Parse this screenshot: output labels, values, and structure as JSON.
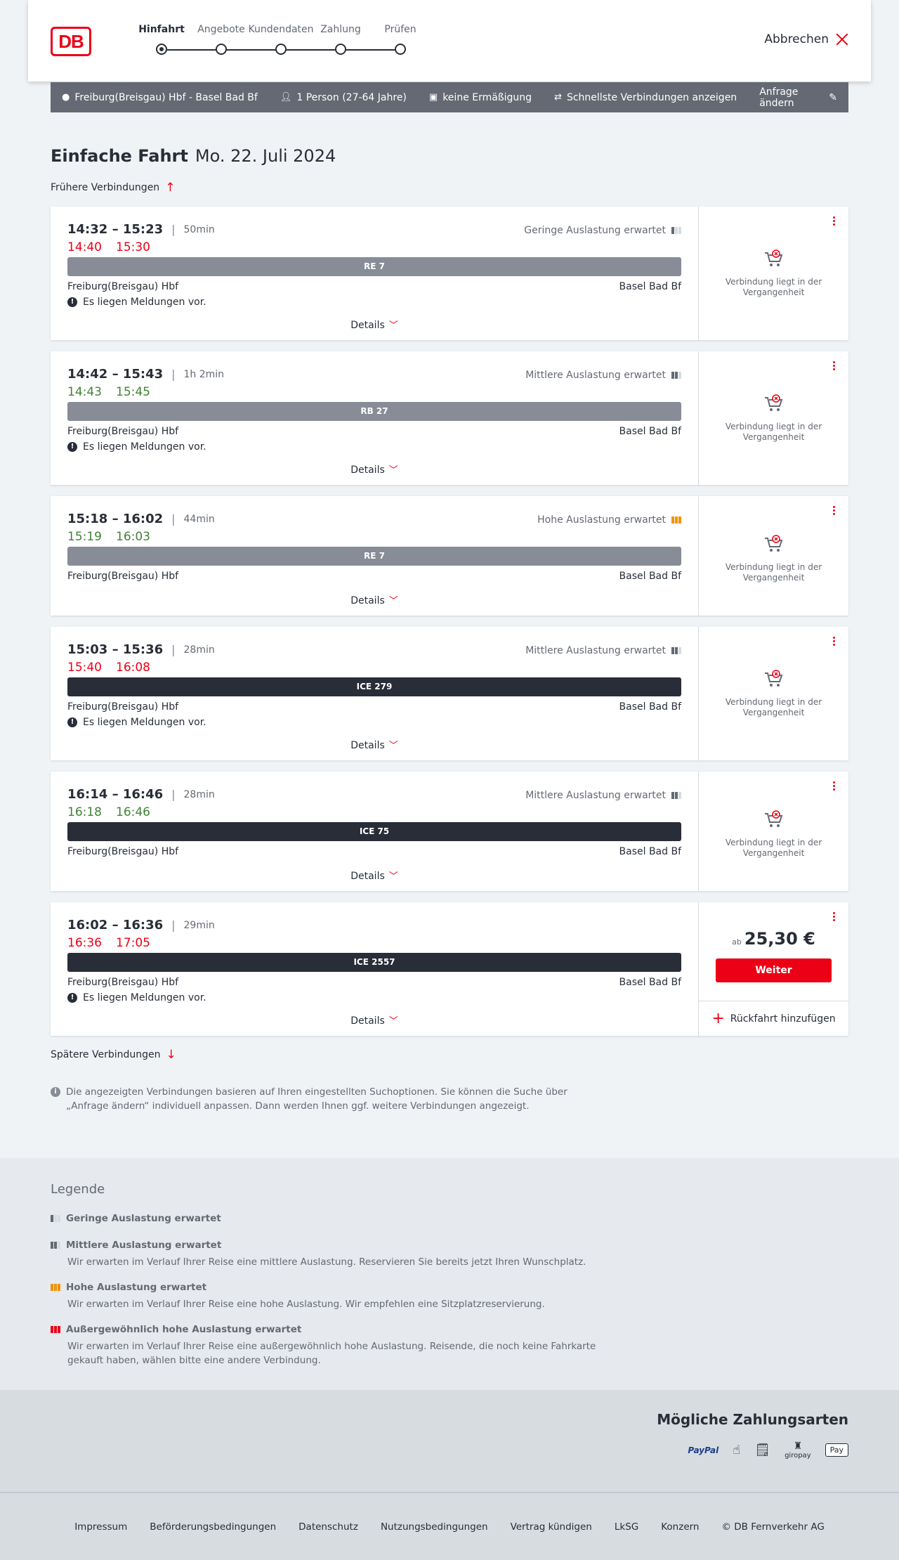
{
  "header": {
    "logo": "DB",
    "steps": [
      "Hinfahrt",
      "Angebote",
      "Kundendaten",
      "Zahlung",
      "Prüfen"
    ],
    "active_step": 0,
    "cancel_label": "Abbrechen"
  },
  "search": {
    "route": "Freiburg(Breisgau) Hbf - Basel Bad Bf",
    "travellers": "1 Person (27-64 Jahre)",
    "discount": "keine Ermäßigung",
    "fastest": "Schnellste Verbindungen anzeigen",
    "edit_label": "Anfrage ändern"
  },
  "page": {
    "trip_type": "Einfache Fahrt",
    "date": "Mo. 22. Juli 2024",
    "earlier": "Frühere Verbindungen",
    "later": "Spätere Verbindungen",
    "info": "Die angezeigten Verbindungen basieren auf Ihren eingestellten Suchoptionen. Sie können die Suche über „Anfrage ändern“ individuell anpassen. Dann werden Ihnen ggf. weitere Verbindungen angezeigt."
  },
  "connections": [
    {
      "times": "14:32 – 15:23",
      "duration": "50min",
      "rt_dep": "14:40",
      "rt_arr": "15:30",
      "rt_status": "late",
      "load": "Geringe Auslastung erwartet",
      "load_level": 1,
      "train": "RE 7",
      "train_type": "reg",
      "from": "Freiburg(Breisgau) Hbf",
      "to": "Basel Bad Bf",
      "message": "Es liegen Meldungen vor.",
      "details": "Details",
      "past": "Verbindung liegt in der Vergangenheit"
    },
    {
      "times": "14:42 – 15:43",
      "duration": "1h 2min",
      "rt_dep": "14:43",
      "rt_arr": "15:45",
      "rt_status": "ok",
      "load": "Mittlere Auslastung erwartet",
      "load_level": 2,
      "train": "RB 27",
      "train_type": "reg",
      "from": "Freiburg(Breisgau) Hbf",
      "to": "Basel Bad Bf",
      "message": "Es liegen Meldungen vor.",
      "details": "Details",
      "past": "Verbindung liegt in der Vergangenheit"
    },
    {
      "times": "15:18 – 16:02",
      "duration": "44min",
      "rt_dep": "15:19",
      "rt_arr": "16:03",
      "rt_status": "ok",
      "load": "Hohe Auslastung erwartet",
      "load_level": 3,
      "train": "RE 7",
      "train_type": "reg",
      "from": "Freiburg(Breisgau) Hbf",
      "to": "Basel Bad Bf",
      "message": "",
      "details": "Details",
      "past": "Verbindung liegt in der Vergangenheit"
    },
    {
      "times": "15:03 – 15:36",
      "duration": "28min",
      "rt_dep": "15:40",
      "rt_arr": "16:08",
      "rt_status": "late",
      "load": "Mittlere Auslastung erwartet",
      "load_level": 2,
      "train": "ICE 279",
      "train_type": "ice",
      "from": "Freiburg(Breisgau) Hbf",
      "to": "Basel Bad Bf",
      "message": "Es liegen Meldungen vor.",
      "details": "Details",
      "past": "Verbindung liegt in der Vergangenheit"
    },
    {
      "times": "16:14 – 16:46",
      "duration": "28min",
      "rt_dep": "16:18",
      "rt_arr": "16:46",
      "rt_status": "ok",
      "load": "Mittlere Auslastung erwartet",
      "load_level": 2,
      "train": "ICE 75",
      "train_type": "ice",
      "from": "Freiburg(Breisgau) Hbf",
      "to": "Basel Bad Bf",
      "message": "",
      "details": "Details",
      "past": "Verbindung liegt in der Vergangenheit"
    },
    {
      "times": "16:02 – 16:36",
      "duration": "29min",
      "rt_dep": "16:36",
      "rt_arr": "17:05",
      "rt_status": "late",
      "load": "",
      "load_level": 0,
      "train": "ICE 2557",
      "train_type": "ice",
      "from": "Freiburg(Breisgau) Hbf",
      "to": "Basel Bad Bf",
      "message": "Es liegen Meldungen vor.",
      "details": "Details",
      "price_prefix": "ab",
      "price": "25,30 €",
      "button": "Weiter",
      "return_label": "Rückfahrt hinzufügen"
    }
  ],
  "legend": {
    "title": "Legende",
    "items": [
      {
        "title": "Geringe Auslastung erwartet",
        "level": 1,
        "desc": ""
      },
      {
        "title": "Mittlere Auslastung erwartet",
        "level": 2,
        "desc": "Wir erwarten im Verlauf Ihrer Reise eine mittlere Auslastung. Reservieren Sie bereits jetzt Ihren Wunschplatz."
      },
      {
        "title": "Hohe Auslastung erwartet",
        "level": 3,
        "desc": "Wir erwarten im Verlauf Ihrer Reise eine hohe Auslastung. Wir empfehlen eine Sitzplatzreservierung."
      },
      {
        "title": "Außergewöhnlich hohe Auslastung erwartet",
        "level": 4,
        "desc": "Wir erwarten im Verlauf Ihrer Reise eine außergewöhnlich hohe Auslastung. Reisende, die noch keine Fahrkarte gekauft haben, wählen bitte eine andere Verbindung."
      }
    ]
  },
  "payment": {
    "title": "Mögliche Zahlungsarten",
    "methods": [
      "PayPal",
      "giropay",
      "Pay"
    ]
  },
  "footer": {
    "links": [
      "Impressum",
      "Beförderungsbedingungen",
      "Datenschutz",
      "Nutzungsbedingungen",
      "Vertrag kündigen",
      "LkSG",
      "Konzern",
      "© DB Fernverkehr AG"
    ]
  },
  "colors": {
    "accent": "#ec0016",
    "late": "#ec0016",
    "on_time": "#408335",
    "high_load": "#f39200",
    "dark": "#282d37"
  }
}
